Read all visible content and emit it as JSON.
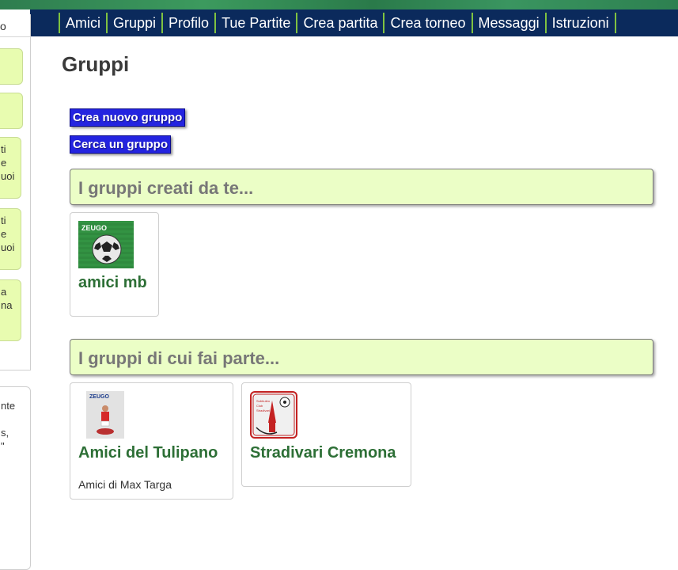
{
  "nav": {
    "items": [
      "Amici",
      "Gruppi",
      "Profilo",
      "Tue Partite",
      "Crea partita",
      "Crea torneo",
      "Messaggi",
      "Istruzioni"
    ]
  },
  "sidebar": {
    "top_label": "o",
    "cards": [
      {
        "lines": []
      },
      {
        "lines": []
      },
      {
        "lines": [
          "ti",
          "e",
          "uoi"
        ]
      },
      {
        "lines": [
          "ti",
          "e",
          "uoi"
        ]
      },
      {
        "lines": [
          "a",
          "na"
        ]
      }
    ],
    "bottom_lines": [
      "nte",
      "",
      "s,",
      "\""
    ]
  },
  "page": {
    "title": "Gruppi",
    "create_button": "Crea nuovo gruppo",
    "search_button": "Cerca un gruppo"
  },
  "sections": {
    "created": {
      "title": "I gruppi creati da te...",
      "groups": [
        {
          "name": "amici mb",
          "description": "",
          "logo": "zeugo-ball-logo",
          "logo_text": "ZEUGO"
        }
      ]
    },
    "member": {
      "title": "I gruppi di cui fai parte...",
      "groups": [
        {
          "name": "Amici del Tulipano",
          "description": "Amici di Max Targa",
          "logo": "zeugo-player-figure-logo",
          "logo_text": "ZEUGO"
        },
        {
          "name": "Stradivari Cremona",
          "description": "",
          "logo": "stradivari-club-logo",
          "logo_text": ""
        }
      ]
    }
  },
  "colors": {
    "navbar": "#0b2a5c",
    "nav_separator": "#7fc241",
    "button": "#2424e0",
    "section_bg": "#ebfec6",
    "group_name": "#2d6f36",
    "sidebar_card": "#e8fcb0"
  }
}
